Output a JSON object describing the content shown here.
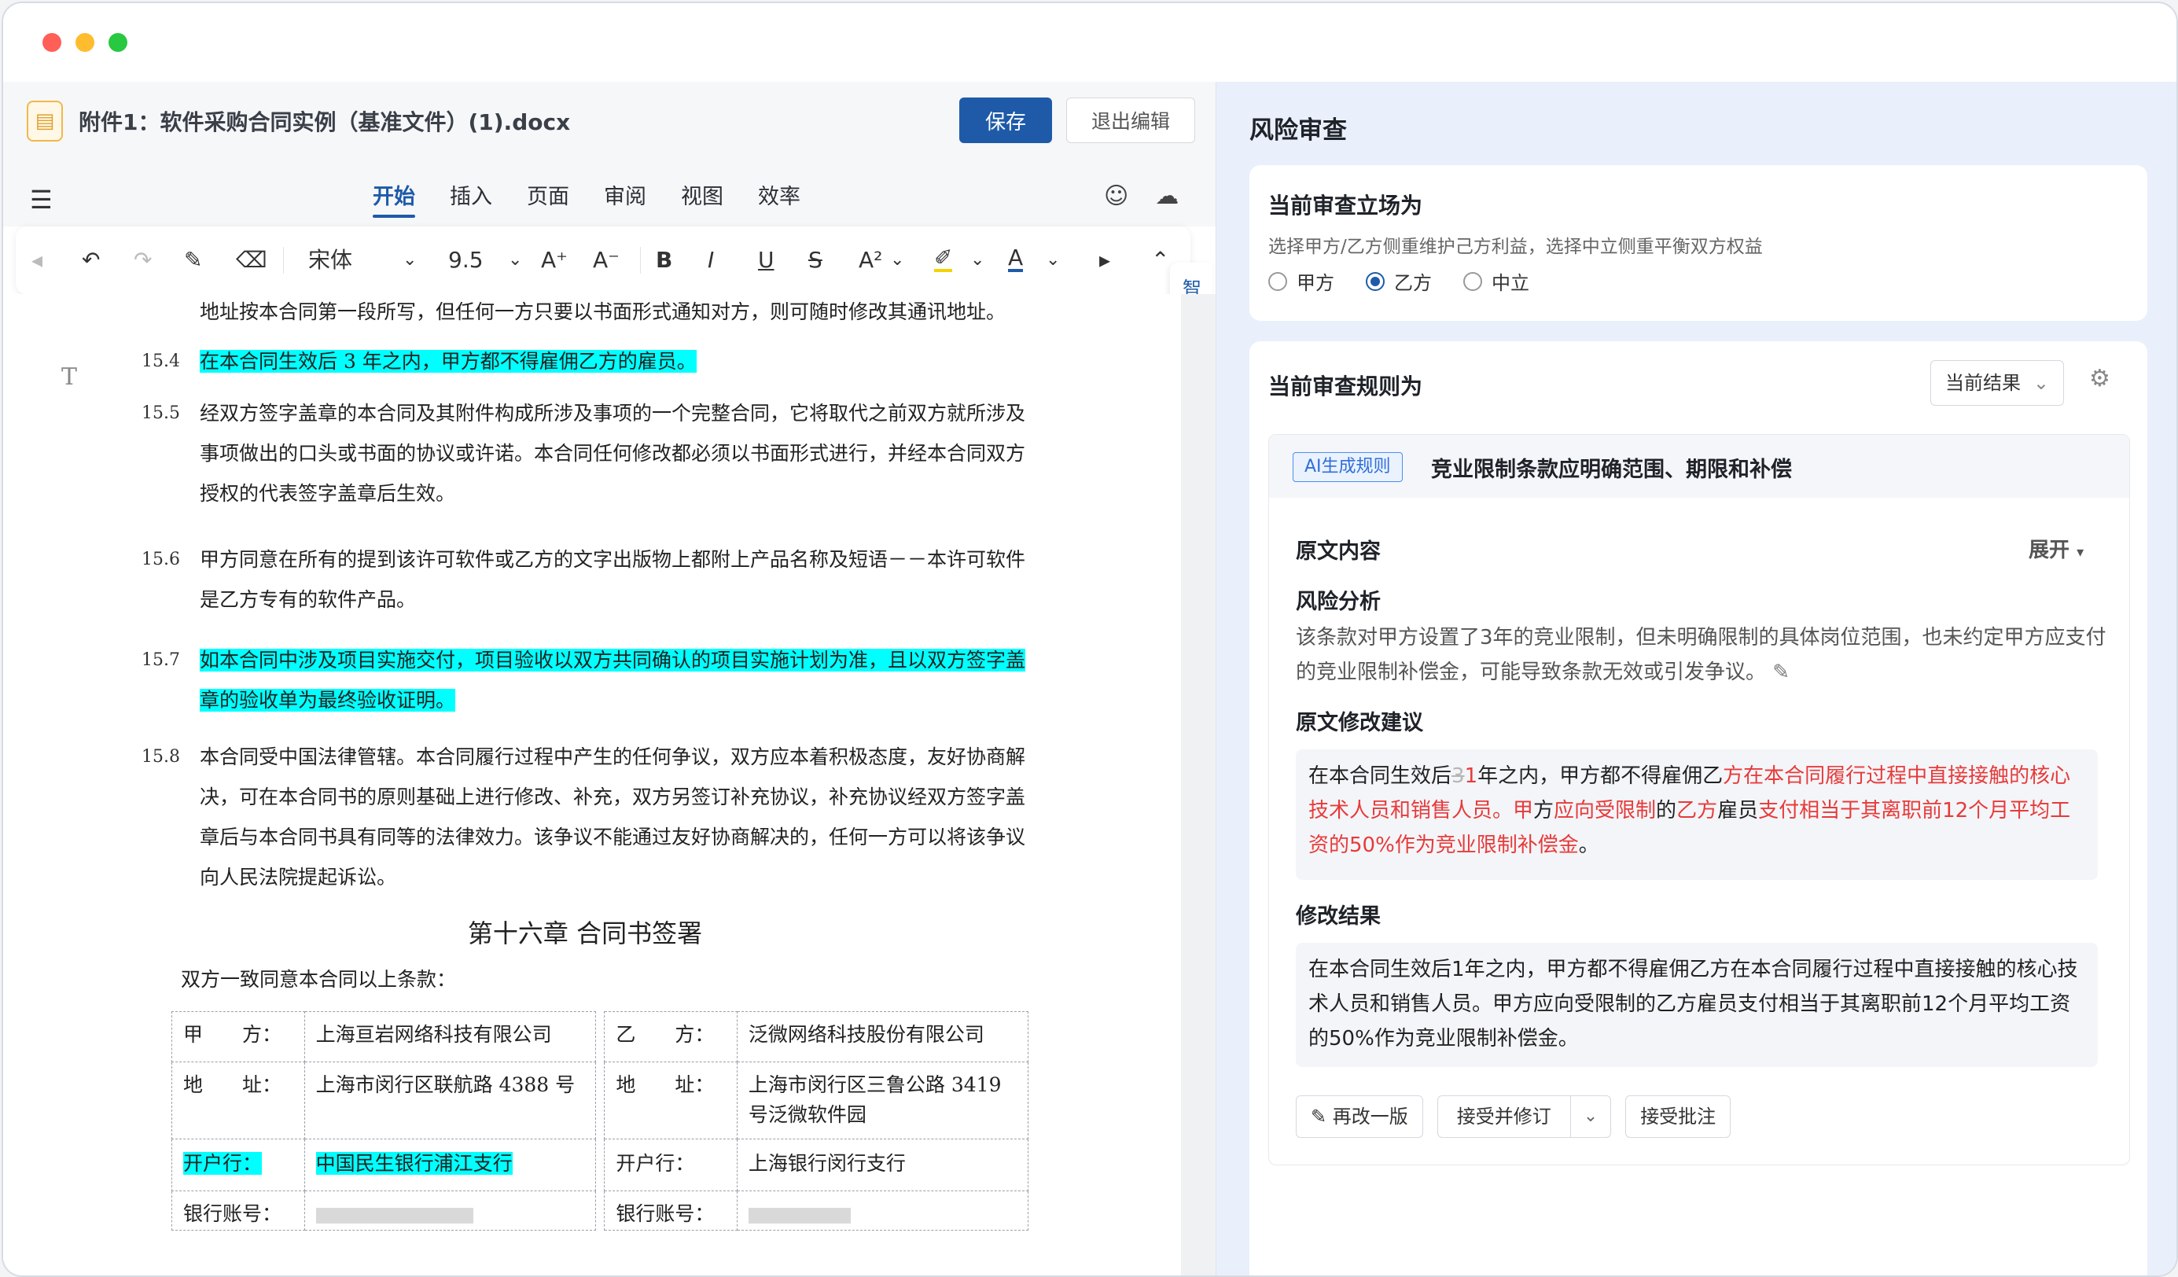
{
  "editor": {
    "file_name": "附件1：软件采购合同实例（基准文件）(1).docx",
    "save_label": "保存",
    "exit_label": "退出编辑",
    "menu_tabs": [
      "开始",
      "插入",
      "页面",
      "审阅",
      "视图",
      "效率"
    ],
    "active_tab": "开始",
    "toolbar": {
      "font_name": "宋体",
      "font_size": "9.5"
    },
    "side_tab_label": "智能助手"
  },
  "document": {
    "line_top": "地址按本合同第一段所写，但任何一方只要以书面形式通知对方，则可随时修改其通讯地址。",
    "clauses": [
      {
        "num": "15.4",
        "text": "在本合同生效后 3 年之内，甲方都不得雇佣乙方的雇员。",
        "highlight": true
      },
      {
        "num": "15.5",
        "text": "经双方签字盖章的本合同及其附件构成所涉及事项的一个完整合同，它将取代之前双方就所涉及事项做出的口头或书面的协议或许诺。本合同任何修改都必须以书面形式进行，并经本合同双方授权的代表签字盖章后生效。",
        "highlight": false
      },
      {
        "num": "15.6",
        "text": "甲方同意在所有的提到该许可软件或乙方的文字出版物上都附上产品名称及短语－－本许可软件是乙方专有的软件产品。",
        "highlight": false
      },
      {
        "num": "15.7",
        "text": "如本合同中涉及项目实施交付，项目验收以双方共同确认的项目实施计划为准，且以双方签字盖章的验收单为最终验收证明。",
        "highlight": true
      },
      {
        "num": "15.8",
        "text": "本合同受中国法律管辖。本合同履行过程中产生的任何争议，双方应本着积极态度，友好协商解决，可在本合同书的原则基础上进行修改、补充，双方另签订补充协议，补充协议经双方签字盖章后与本合同书具有同等的法律效力。该争议不能通过友好协商解决的，任何一方可以将该争议向人民法院提起诉讼。",
        "highlight": false
      }
    ],
    "chapter_title": "第十六章 合同书签署",
    "agree_text": "双方一致同意本合同以上条款：",
    "table": {
      "party_a_label": "甲　　方：",
      "party_a": "上海亘岩网络科技有限公司",
      "party_b_label": "乙　　方：",
      "party_b": "泛微网络科技股份有限公司",
      "addr_label": "地　　址：",
      "addr_a": "上海市闵行区联航路 4388 号",
      "addr_b": "上海市闵行区三鲁公路 3419 号泛微软件园",
      "bank_label": "开户行：",
      "bank_a": "中国民生银行浦江支行",
      "bank_b": "上海银行闵行支行",
      "account_label": "银行账号："
    }
  },
  "review": {
    "title": "风险审查",
    "stance": {
      "title": "当前审查立场为",
      "desc": "选择甲方/乙方侧重维护己方利益，选择中立侧重平衡双方权益",
      "options": [
        "甲方",
        "乙方",
        "中立"
      ],
      "selected": "乙方"
    },
    "rules": {
      "title": "当前审查规则为",
      "select_value": "当前结果",
      "badge": "AI生成规则",
      "rule_name": "竞业限制条款应明确范围、期限和补偿",
      "original_label": "原文内容",
      "expand_label": "展开",
      "analysis_label": "风险分析",
      "analysis_text": "该条款对甲方设置了3年的竞业限制，但未明确限制的具体岗位范围，也未约定甲方应支付的竞业限制补偿金，可能导致条款无效或引发争议。",
      "suggestion_label": "原文修改建议",
      "suggestion_segments": [
        {
          "t": "在本合同生效后",
          "k": "n"
        },
        {
          "t": "3",
          "k": "d"
        },
        {
          "t": "1",
          "k": "a"
        },
        {
          "t": "年之内，甲方都不得雇佣乙",
          "k": "n"
        },
        {
          "t": "方在本合同履行过程中直接接触的核心技术人员和销售人员。甲",
          "k": "a"
        },
        {
          "t": "方",
          "k": "n"
        },
        {
          "t": "应向受限制",
          "k": "a"
        },
        {
          "t": "的",
          "k": "n"
        },
        {
          "t": "乙方",
          "k": "a"
        },
        {
          "t": "雇员",
          "k": "n"
        },
        {
          "t": "支付相当于其离职前12个月平均工资的50%作为竞业限制补偿金",
          "k": "a"
        },
        {
          "t": "。",
          "k": "n"
        }
      ],
      "result_label": "修改结果",
      "result_text": "在本合同生效后1年之内，甲方都不得雇佣乙方在本合同履行过程中直接接触的核心技术人员和销售人员。甲方应向受限制的乙方雇员支付相当于其离职前12个月平均工资的50%作为竞业限制补偿金。",
      "btn_rewrite": "再改一版",
      "btn_accept_revise": "接受并修订",
      "btn_accept_comment": "接受批注"
    }
  }
}
